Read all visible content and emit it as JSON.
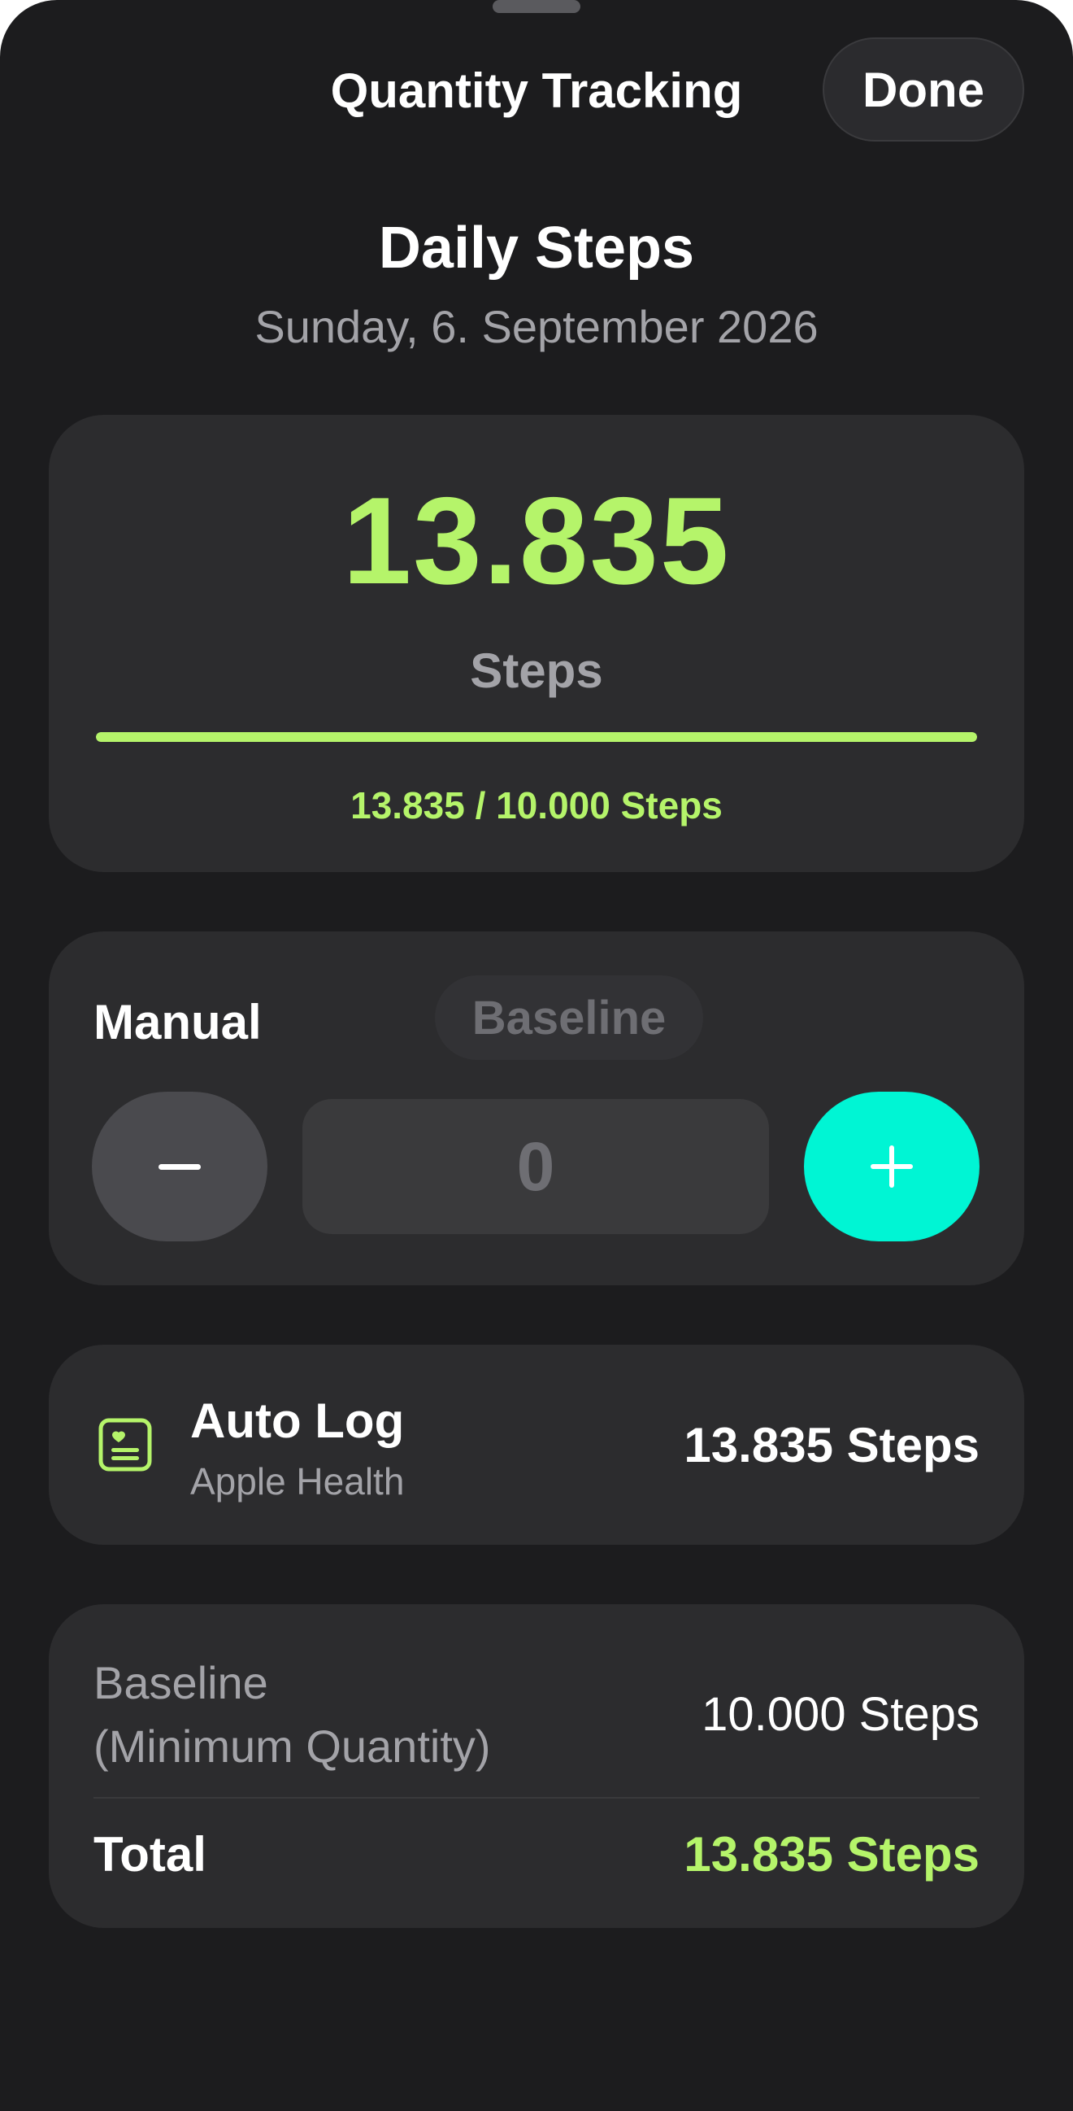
{
  "nav": {
    "title": "Quantity Tracking",
    "done_label": "Done"
  },
  "header": {
    "title": "Daily Steps",
    "date": "Sunday, 6. September 2026"
  },
  "summary": {
    "count": "13.835",
    "unit": "Steps",
    "progress_fraction": 1.0,
    "progress_caption": "13.835 / 10.000 Steps"
  },
  "manual": {
    "label": "Manual",
    "baseline_toggle": "Baseline",
    "value": "0",
    "decrement_icon": "minus-icon",
    "increment_icon": "plus-icon"
  },
  "autolog": {
    "icon": "health-record-icon",
    "title": "Auto Log",
    "source": "Apple Health",
    "value": "13.835 Steps"
  },
  "totals": {
    "baseline_label": "Baseline\n(Minimum Quantity)",
    "baseline_value": "10.000 Steps",
    "total_label": "Total",
    "total_value": "13.835 Steps"
  },
  "colors": {
    "accent_green": "#b5f46a",
    "accent_teal": "#00f5d4",
    "background": "#1c1c1e",
    "card": "#2c2c2e"
  }
}
